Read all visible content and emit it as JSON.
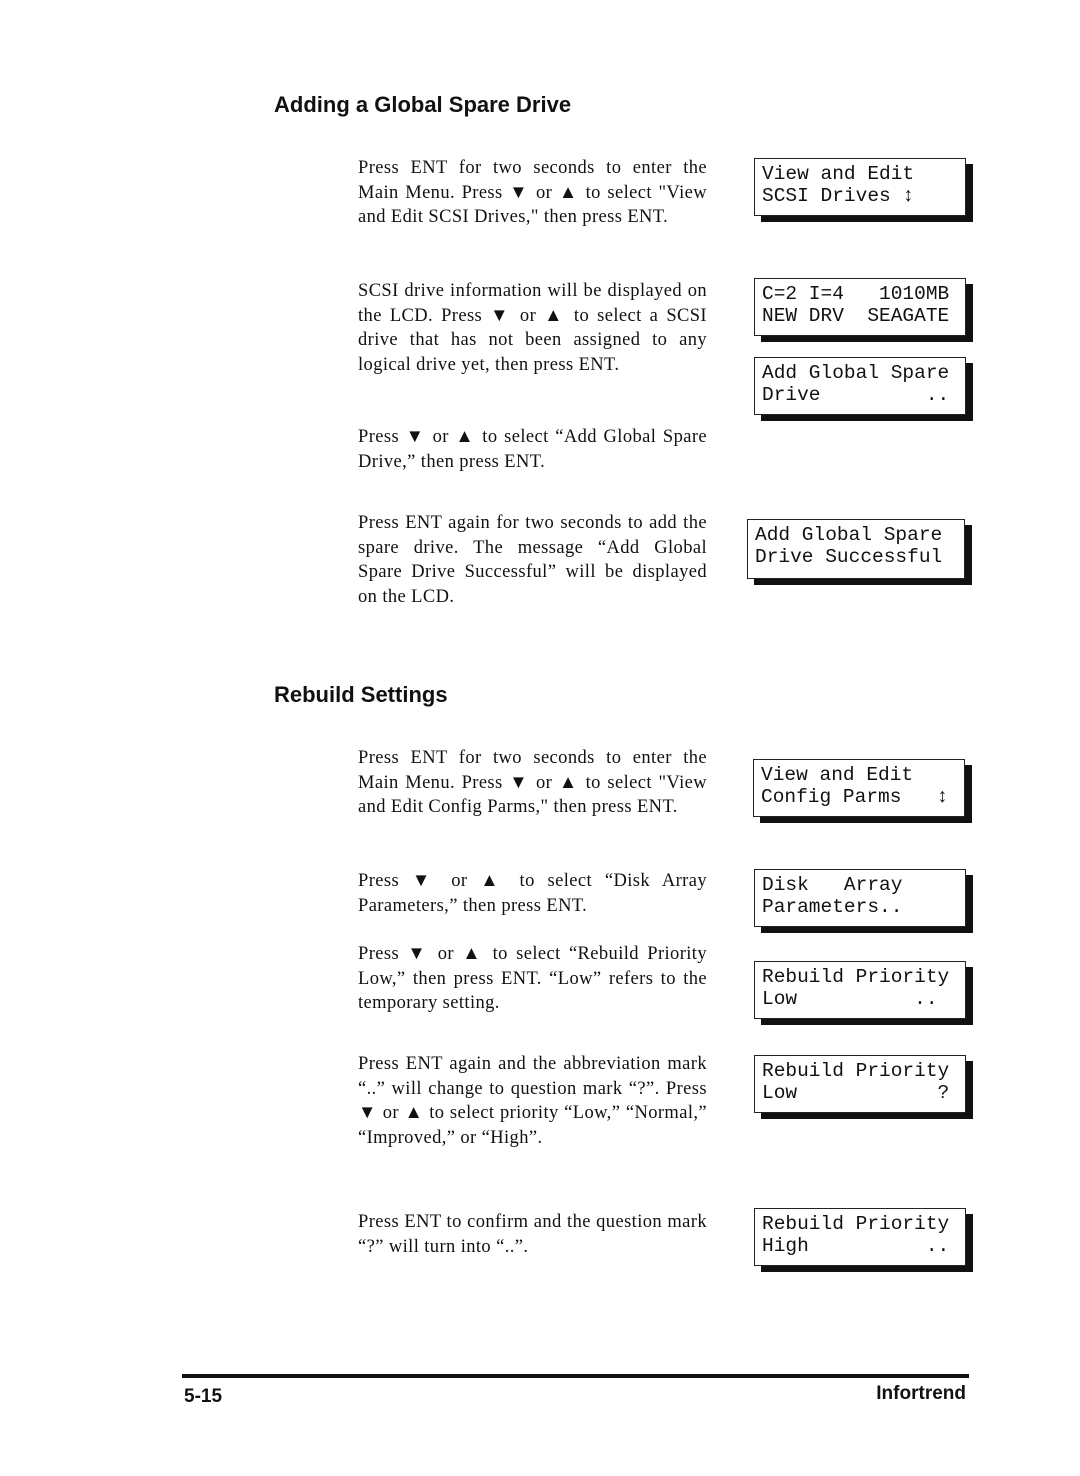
{
  "sections": [
    {
      "title": "Adding a Global Spare Drive"
    },
    {
      "title": "Rebuild Settings"
    }
  ],
  "paragraphs": [
    "Press ENT for two seconds to enter the Main Menu.  Press ▼ or ▲ to select \"View and Edit SCSI Drives,\" then press ENT.",
    "SCSI drive information will be displayed on the LCD. Press ▼ or ▲ to select a SCSI drive that has not been assigned to any logical drive yet, then press ENT.",
    "Press ▼ or ▲ to select “Add Global Spare Drive,” then press ENT.",
    "Press ENT again for two seconds to add the spare drive. The message “Add Global Spare Drive Successful” will be displayed on the LCD.",
    "Press ENT for two seconds to enter the Main Menu.  Press ▼ or ▲ to select \"View and Edit Config Parms,\" then press ENT.",
    "Press ▼ or ▲ to select “Disk Array Parameters,” then press ENT.",
    "Press ▼ or ▲ to select “Rebuild Priority Low,” then press ENT. “Low” refers to the temporary setting.",
    "Press ENT again and the abbreviation mark “..” will change to question mark “?”.  Press ▼ or ▲ to select priority “Low,” “Normal,” “Improved,” or “High”.",
    "Press ENT to confirm and the question mark “?” will turn into “..”."
  ],
  "lcds": [
    {
      "line1": "View and Edit",
      "line2": "SCSI Drives ↕"
    },
    {
      "line1": "C=2 I=4   1010MB",
      "line2": "NEW DRV  SEAGATE"
    },
    {
      "line1": "Add Global Spare",
      "line2": "Drive         .."
    },
    {
      "line1": "Add Global Spare",
      "line2": "Drive Successful"
    },
    {
      "line1": "View and Edit",
      "line2": "Config Parms   ↕"
    },
    {
      "line1": "Disk   Array",
      "line2": "Parameters.."
    },
    {
      "line1": "Rebuild Priority",
      "line2": "Low          .."
    },
    {
      "line1": "Rebuild Priority",
      "line2": "Low            ?"
    },
    {
      "line1": "Rebuild Priority",
      "line2": "High          .."
    }
  ],
  "footer": {
    "page": "5-15",
    "brand": "Infortrend"
  }
}
